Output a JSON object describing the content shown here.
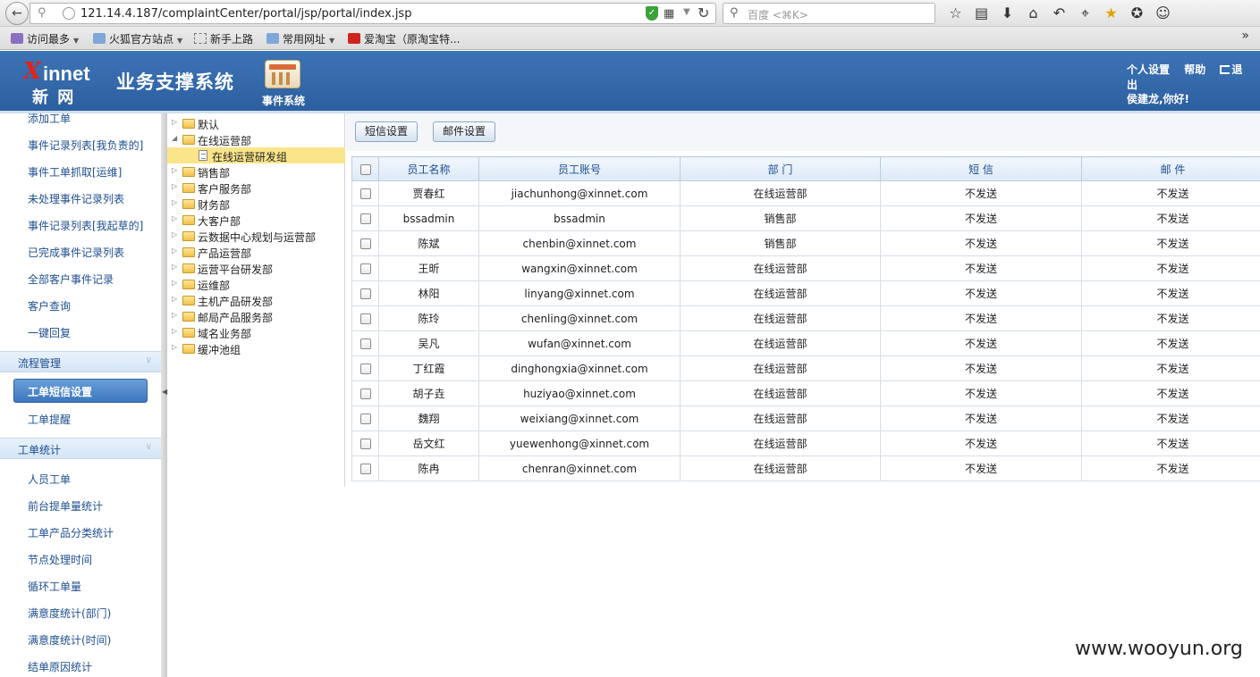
{
  "browser": {
    "url": "121.14.4.187/complaintCenter/portal/jsp/portal/index.jsp",
    "search_placeholder": "百度 <⌘K>",
    "bookmarks": [
      "访问最多",
      "火狐官方站点",
      "新手上路",
      "常用网址",
      "爱淘宝（原淘宝特..."
    ],
    "icons": [
      "back-arrow-icon",
      "key-icon",
      "globe-icon",
      "shield-icon",
      "qr-icon",
      "reload-icon",
      "search-icon",
      "star-icon",
      "reading-list-icon",
      "download-icon",
      "home-icon",
      "undo-icon",
      "crop-icon",
      "addon-star-icon",
      "bird-icon",
      "smiley-icon"
    ]
  },
  "header": {
    "logo_text": "innet",
    "logo_cn": "新 网",
    "title": "业务支撑系统",
    "module_label": "事件系统",
    "links": {
      "settings": "个人设置",
      "help": "帮助",
      "logout": "退出"
    },
    "greeting": "侯建龙,你好!"
  },
  "sidebar": {
    "items_top": [
      "添加工单",
      "事件记录列表[我负责的]",
      "事件工单抓取[运维]",
      "未处理事件记录列表",
      "事件记录列表[我起草的]",
      "已完成事件记录列表",
      "全部客户事件记录",
      "客户查询",
      "一键回复"
    ],
    "group_process": "流程管理",
    "active_item": "工单短信设置",
    "item_remind": "工单提醒",
    "group_stats": "工单统计",
    "items_stats": [
      "人员工单",
      "前台提单量统计",
      "工单产品分类统计",
      "节点处理时间",
      "循环工单量",
      "满意度统计(部门)",
      "满意度统计(时间)",
      "结单原因统计"
    ]
  },
  "tree": {
    "nodes": [
      {
        "label": "默认",
        "expanded": false
      },
      {
        "label": "在线运营部",
        "expanded": true
      },
      {
        "label": "在线运营研发组",
        "selected": true,
        "leaf": true
      },
      {
        "label": "销售部"
      },
      {
        "label": "客户服务部"
      },
      {
        "label": "财务部"
      },
      {
        "label": "大客户部"
      },
      {
        "label": "云数据中心规划与运营部"
      },
      {
        "label": "产品运营部"
      },
      {
        "label": "运营平台研发部"
      },
      {
        "label": "运维部"
      },
      {
        "label": "主机产品研发部"
      },
      {
        "label": "邮局产品服务部"
      },
      {
        "label": "域名业务部"
      },
      {
        "label": "缓冲池组"
      }
    ]
  },
  "toolbar": {
    "sms_settings": "短信设置",
    "mail_settings": "邮件设置"
  },
  "table": {
    "columns": [
      "员工名称",
      "员工账号",
      "部 门",
      "短 信",
      "邮 件"
    ],
    "rows": [
      [
        "贾春红",
        "jiachunhong@xinnet.com",
        "在线运营部",
        "不发送",
        "不发送"
      ],
      [
        "bssadmin",
        "bssadmin",
        "销售部",
        "不发送",
        "不发送"
      ],
      [
        "陈斌",
        "chenbin@xinnet.com",
        "销售部",
        "不发送",
        "不发送"
      ],
      [
        "王昕",
        "wangxin@xinnet.com",
        "在线运营部",
        "不发送",
        "不发送"
      ],
      [
        "林阳",
        "linyang@xinnet.com",
        "在线运营部",
        "不发送",
        "不发送"
      ],
      [
        "陈玲",
        "chenling@xinnet.com",
        "在线运营部",
        "不发送",
        "不发送"
      ],
      [
        "吴凡",
        "wufan@xinnet.com",
        "在线运营部",
        "不发送",
        "不发送"
      ],
      [
        "丁红霞",
        "dinghongxia@xinnet.com",
        "在线运营部",
        "不发送",
        "不发送"
      ],
      [
        "胡子垚",
        "huziyao@xinnet.com",
        "在线运营部",
        "不发送",
        "不发送"
      ],
      [
        "魏翔",
        "weixiang@xinnet.com",
        "在线运营部",
        "不发送",
        "不发送"
      ],
      [
        "岳文红",
        "yuewenhong@xinnet.com",
        "在线运营部",
        "不发送",
        "不发送"
      ],
      [
        "陈冉",
        "chenran@xinnet.com",
        "在线运营部",
        "不发送",
        "不发送"
      ]
    ]
  },
  "watermark": "www.wooyun.org",
  "colors": {
    "header_blue": "#2c5f9f",
    "tree_selected": "#fbe58a",
    "link_blue": "#1d4e8f"
  }
}
